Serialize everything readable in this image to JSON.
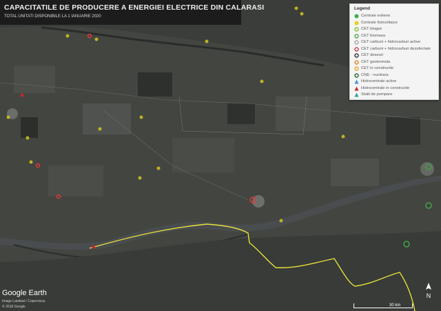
{
  "title": "CAPACITATILE DE PRODUCERE A ENERGIEI ELECTRICE DIN CALARASI",
  "subtitle": "TOTAL UNITATI DISPONIBILE LA 1 IANUARIE 2020",
  "legend": {
    "title": "Legend",
    "items": [
      {
        "label": "Centrale eoliene",
        "icon": "green-dot-icon",
        "color": "#3fae49"
      },
      {
        "label": "Centrale fotovoltaice",
        "icon": "yellow-dot-icon",
        "color": "#e3d21b"
      },
      {
        "label": "CET biogaz",
        "icon": "green-ring-icon",
        "color": "#6fbf3a"
      },
      {
        "label": "CET biomasa",
        "icon": "green-ring-icon",
        "color": "#43a047"
      },
      {
        "label": "CET carbuni + hidrocarburi active",
        "icon": "grey-ring-icon",
        "color": "#9e9e9e"
      },
      {
        "label": "CET carbuni + hidrocarburi dezafectate",
        "icon": "red-ring-icon",
        "color": "#d32f2f"
      },
      {
        "label": "CET deseuri",
        "icon": "black-ring-icon",
        "color": "#222222"
      },
      {
        "label": "CET geotermala",
        "icon": "orange-ring-icon",
        "color": "#e67e22"
      },
      {
        "label": "CET in constructie",
        "icon": "orange-ring-icon",
        "color": "#f39c12"
      },
      {
        "label": "CNE - nucleara",
        "icon": "dark-green-ring-icon",
        "color": "#1b5e20"
      },
      {
        "label": "Hidrocentrale active",
        "icon": "blue-triangle-icon",
        "color": "#4a90d9"
      },
      {
        "label": "Hidrocentrale in constructie",
        "icon": "red-triangle-icon",
        "color": "#c62828"
      },
      {
        "label": "Statii de pompare",
        "icon": "teal-triangle-icon",
        "color": "#26a69a"
      }
    ]
  },
  "footer": {
    "logo": "Google Earth",
    "credit_lines": [
      "Image Landsat / Copernicus",
      "© 2018 Google"
    ],
    "scale_label": "30 km",
    "compass_label": "N"
  },
  "colors": {
    "border_line": "#e8e23a",
    "river": "#4a4d4f",
    "background": "#3a3b38"
  }
}
